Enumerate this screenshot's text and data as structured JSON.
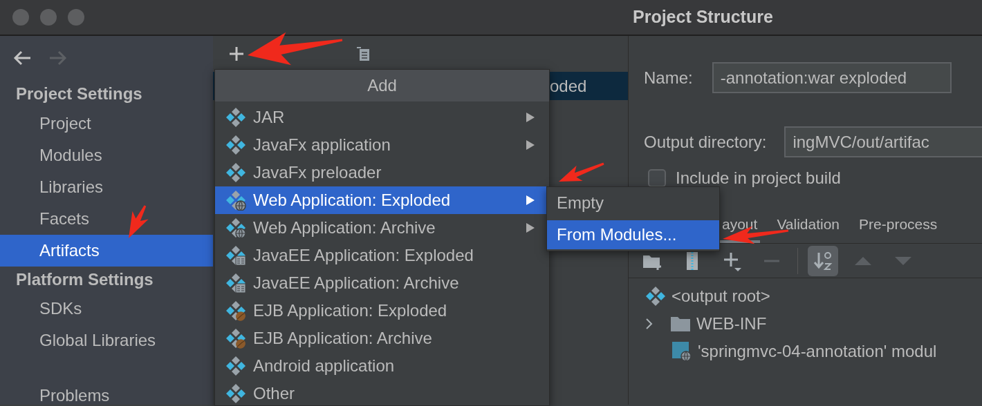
{
  "window": {
    "title": "Project Structure"
  },
  "nav": [
    {
      "kind": "back",
      "disabled": false
    },
    {
      "kind": "forward",
      "disabled": true
    }
  ],
  "sidebar": {
    "sections": [
      {
        "title": "Project Settings",
        "items": [
          {
            "label": "Project",
            "selected": false
          },
          {
            "label": "Modules",
            "selected": false
          },
          {
            "label": "Libraries",
            "selected": false
          },
          {
            "label": "Facets",
            "selected": false
          },
          {
            "label": "Artifacts",
            "selected": true
          }
        ]
      },
      {
        "title": "Platform Settings",
        "items": [
          {
            "label": "SDKs",
            "selected": false
          },
          {
            "label": "Global Libraries",
            "selected": false
          }
        ]
      }
    ],
    "footer_items": [
      {
        "label": "Problems",
        "selected": false
      }
    ]
  },
  "artifacts_list": {
    "rows": [
      {
        "label": "oded",
        "selected": true
      }
    ]
  },
  "add_menu": {
    "title": "Add",
    "items": [
      {
        "label": "JAR",
        "kind": "plain",
        "has_submenu": true,
        "selected": false
      },
      {
        "label": "JavaFx application",
        "kind": "plain",
        "has_submenu": true,
        "selected": false
      },
      {
        "label": "JavaFx preloader",
        "kind": "plain",
        "has_submenu": false,
        "selected": false
      },
      {
        "label": "Web Application: Exploded",
        "kind": "web",
        "has_submenu": true,
        "selected": true
      },
      {
        "label": "Web Application: Archive",
        "kind": "web",
        "has_submenu": true,
        "selected": false
      },
      {
        "label": "JavaEE Application: Exploded",
        "kind": "javaee",
        "has_submenu": false,
        "selected": false
      },
      {
        "label": "JavaEE Application: Archive",
        "kind": "javaee",
        "has_submenu": false,
        "selected": false
      },
      {
        "label": "EJB Application: Exploded",
        "kind": "ejb",
        "has_submenu": false,
        "selected": false
      },
      {
        "label": "EJB Application: Archive",
        "kind": "ejb",
        "has_submenu": false,
        "selected": false
      },
      {
        "label": "Android application",
        "kind": "plain",
        "has_submenu": false,
        "selected": false
      },
      {
        "label": "Other",
        "kind": "plain",
        "has_submenu": false,
        "selected": false
      }
    ]
  },
  "submenu": {
    "items": [
      {
        "label": "Empty",
        "selected": false
      },
      {
        "label": "From Modules...",
        "selected": true
      }
    ]
  },
  "details": {
    "name": {
      "label": "Name:",
      "value": "-annotation:war exploded"
    },
    "output_directory": {
      "label": "Output directory:",
      "value": "ingMVC/out/artifac"
    },
    "include_in_build": {
      "label": "Include in project build",
      "checked": false
    },
    "tabs": [
      {
        "label": "ayout",
        "selected": true
      },
      {
        "label": "Validation",
        "selected": false
      },
      {
        "label": "Pre-process",
        "selected": false
      }
    ],
    "toolbar": [
      {
        "kind": "new-folder",
        "disabled": false,
        "on": false
      },
      {
        "kind": "archive",
        "disabled": false,
        "on": false
      },
      {
        "kind": "add",
        "disabled": false,
        "on": false
      },
      {
        "kind": "remove",
        "disabled": true,
        "on": false
      },
      {
        "kind": "sort",
        "disabled": false,
        "on": true
      },
      {
        "kind": "up",
        "disabled": true,
        "on": false
      },
      {
        "kind": "down",
        "disabled": true,
        "on": false
      }
    ],
    "tree": [
      {
        "label": "<output root>",
        "kind": "root"
      },
      {
        "label": "WEB-INF",
        "kind": "folder",
        "expanded": false
      },
      {
        "label": "'springmvc-04-annotation' modul",
        "kind": "module"
      }
    ]
  }
}
